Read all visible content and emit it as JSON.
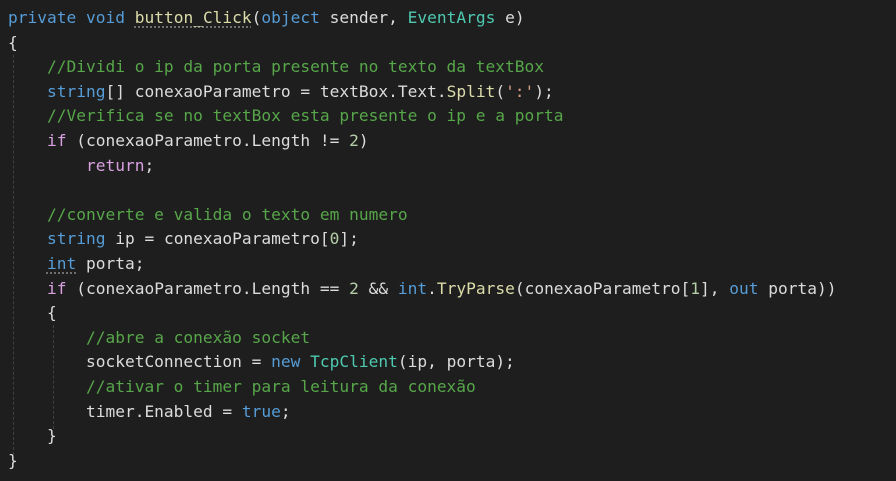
{
  "editor": {
    "language": "C#",
    "theme": "dark",
    "background": "#1e1e1e",
    "colors": {
      "keyword": "#569cd6",
      "control": "#d8a0df",
      "comment": "#57a64a",
      "type": "#4ec9b0",
      "method": "#dcdcaa",
      "string": "#d69d85",
      "number": "#b5cea8",
      "plain": "#dcdcdc"
    },
    "lines": [
      [
        [
          "keyword",
          "private"
        ],
        [
          "plain",
          " "
        ],
        [
          "keyword",
          "void"
        ],
        [
          "plain",
          " "
        ],
        [
          "method-dotted",
          "button_Click"
        ],
        [
          "plain",
          "("
        ],
        [
          "keyword",
          "object"
        ],
        [
          "plain",
          " sender, "
        ],
        [
          "type",
          "EventArgs"
        ],
        [
          "plain",
          " e)"
        ]
      ],
      [
        [
          "plain",
          "{"
        ]
      ],
      [
        [
          "plain",
          "    "
        ],
        [
          "comment",
          "//Dividi o ip da porta presente no texto da textBox"
        ]
      ],
      [
        [
          "plain",
          "    "
        ],
        [
          "keyword",
          "string"
        ],
        [
          "plain",
          "[] conexaoParametro = textBox.Text."
        ],
        [
          "method",
          "Split"
        ],
        [
          "plain",
          "("
        ],
        [
          "string",
          "':'"
        ],
        [
          "plain",
          ");"
        ]
      ],
      [
        [
          "plain",
          "    "
        ],
        [
          "comment",
          "//Verifica se no textBox esta presente o ip e a porta"
        ]
      ],
      [
        [
          "plain",
          "    "
        ],
        [
          "control",
          "if"
        ],
        [
          "plain",
          " (conexaoParametro.Length != "
        ],
        [
          "number",
          "2"
        ],
        [
          "plain",
          ")"
        ]
      ],
      [
        [
          "plain",
          "        "
        ],
        [
          "control",
          "return"
        ],
        [
          "plain",
          ";"
        ]
      ],
      [
        [
          "plain",
          ""
        ]
      ],
      [
        [
          "plain",
          "    "
        ],
        [
          "comment",
          "//converte e valida o texto em numero"
        ]
      ],
      [
        [
          "plain",
          "    "
        ],
        [
          "keyword",
          "string"
        ],
        [
          "plain",
          " ip = conexaoParametro["
        ],
        [
          "number",
          "0"
        ],
        [
          "plain",
          "];"
        ]
      ],
      [
        [
          "plain",
          "    "
        ],
        [
          "keyword-dotted",
          "int"
        ],
        [
          "plain",
          " porta;"
        ]
      ],
      [
        [
          "plain",
          "    "
        ],
        [
          "control",
          "if"
        ],
        [
          "plain",
          " (conexaoParametro.Length == "
        ],
        [
          "number",
          "2"
        ],
        [
          "plain",
          " && "
        ],
        [
          "keyword",
          "int"
        ],
        [
          "plain",
          "."
        ],
        [
          "method",
          "TryParse"
        ],
        [
          "plain",
          "(conexaoParametro["
        ],
        [
          "number",
          "1"
        ],
        [
          "plain",
          "], "
        ],
        [
          "keyword",
          "out"
        ],
        [
          "plain",
          " porta))"
        ]
      ],
      [
        [
          "plain",
          "    {"
        ]
      ],
      [
        [
          "plain",
          "        "
        ],
        [
          "comment",
          "//abre a conexão socket"
        ]
      ],
      [
        [
          "plain",
          "        socketConnection = "
        ],
        [
          "keyword",
          "new"
        ],
        [
          "plain",
          " "
        ],
        [
          "type",
          "TcpClient"
        ],
        [
          "plain",
          "(ip, porta);"
        ]
      ],
      [
        [
          "plain",
          "        "
        ],
        [
          "comment",
          "//ativar o timer para leitura da conexão"
        ]
      ],
      [
        [
          "plain",
          "        timer.Enabled = "
        ],
        [
          "keyword",
          "true"
        ],
        [
          "plain",
          ";"
        ]
      ],
      [
        [
          "plain",
          "    }"
        ]
      ],
      [
        [
          "plain",
          "}"
        ]
      ]
    ]
  }
}
